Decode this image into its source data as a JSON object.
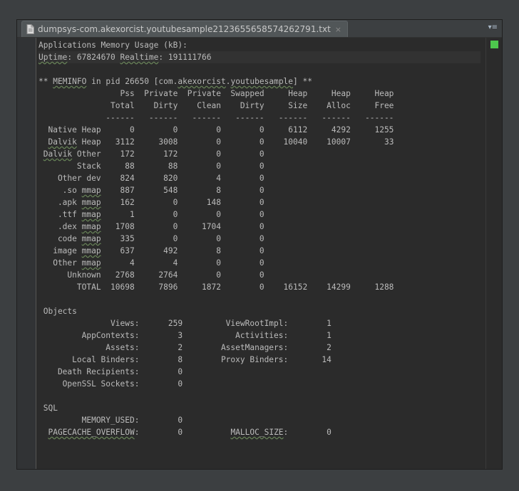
{
  "tab": {
    "title": "dumpsys-com.akexorcist.youtubesample2123655658574262791.txt",
    "close_glyph": "×",
    "menu_glyph": "▾≡"
  },
  "editor": {
    "status_color": "#4dc74d",
    "lines": [
      "Applications Memory Usage (kB):",
      "Uptime: 67824670 Realtime: 191111766",
      "",
      "** MEMINFO in pid 26650 [com.akexorcist.youtubesample] **",
      "                 Pss  Private  Private  Swapped     Heap     Heap     Heap",
      "               Total    Dirty    Clean    Dirty     Size    Alloc     Free",
      "              ------   ------   ------   ------   ------   ------   ------",
      "  Native Heap      0        0        0        0     6112     4292     1255",
      "  Dalvik Heap   3112     3008        0        0    10040    10007       33",
      " Dalvik Other    172      172        0        0",
      "        Stack     88       88        0        0",
      "    Other dev    824      820        4        0",
      "     .so mmap    887      548        8        0",
      "    .apk mmap    162        0      148        0",
      "    .ttf mmap      1        0        0        0",
      "    .dex mmap   1708        0     1704        0",
      "    code mmap    335        0        0        0",
      "   image mmap    637      492        8        0",
      "   Other mmap      4        4        0        0",
      "      Unknown   2768     2764        0        0",
      "        TOTAL  10698     7896     1872        0    16152    14299     1288",
      "",
      " Objects",
      "               Views:      259         ViewRootImpl:        1",
      "         AppContexts:        3           Activities:        1",
      "              Assets:        2        AssetManagers:        2",
      "       Local Binders:        8        Proxy Binders:       14",
      "    Death Recipients:        0",
      "     OpenSSL Sockets:        0",
      "",
      " SQL",
      "         MEMORY_USED:        0",
      "  PAGECACHE_OVERFLOW:        0          MALLOC_SIZE:        0",
      "",
      ""
    ]
  }
}
